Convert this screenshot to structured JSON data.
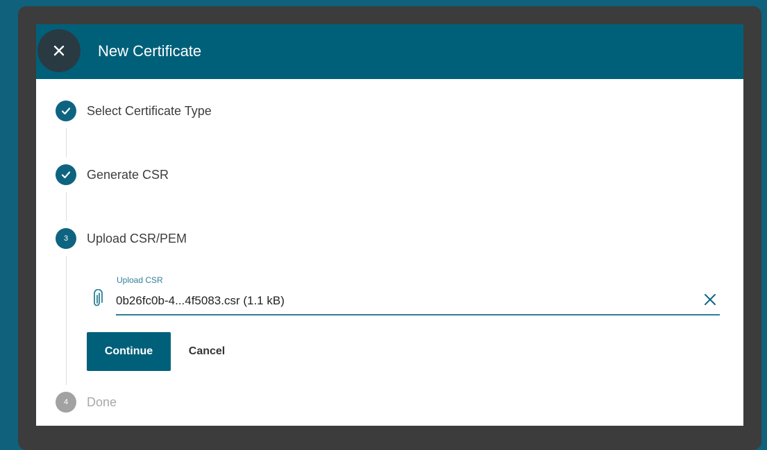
{
  "dialog": {
    "title": "New Certificate",
    "close_icon": "close-icon"
  },
  "steps": [
    {
      "number": "1",
      "label": "Select Certificate Type",
      "status": "complete",
      "icon": "check-icon"
    },
    {
      "number": "2",
      "label": "Generate CSR",
      "status": "complete",
      "icon": "check-icon"
    },
    {
      "number": "3",
      "label": "Upload CSR/PEM",
      "status": "active"
    },
    {
      "number": "4",
      "label": "Done",
      "status": "pending"
    }
  ],
  "upload": {
    "label": "Upload CSR",
    "value": "0b26fc0b-4...4f5083.csr (1.1 kB)",
    "attach_icon": "paperclip-icon",
    "clear_icon": "clear-icon"
  },
  "actions": {
    "continue_label": "Continue",
    "cancel_label": "Cancel"
  },
  "colors": {
    "page_background": "#0f617c",
    "frame": "#3c3c3c",
    "header": "#00607a",
    "accent": "#0e6480",
    "pending": "#a2a2a2"
  }
}
